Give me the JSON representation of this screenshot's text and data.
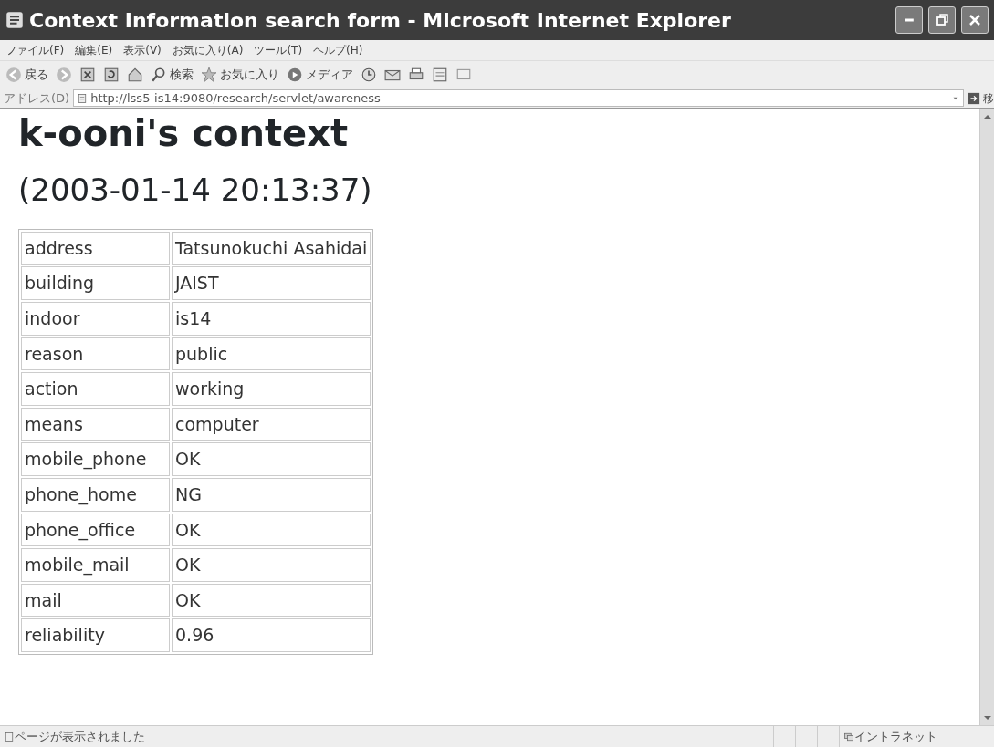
{
  "window": {
    "title": "Context Information search form - Microsoft Internet Explorer"
  },
  "menu": [
    "ファイル(F)",
    "編集(E)",
    "表示(V)",
    "お気に入り(A)",
    "ツール(T)",
    "ヘルプ(H)"
  ],
  "toolbar": [
    {
      "kind": "back",
      "label": "戻る"
    },
    {
      "kind": "forward"
    },
    {
      "kind": "stop"
    },
    {
      "kind": "refresh"
    },
    {
      "kind": "home"
    },
    {
      "kind": "search",
      "label": "検索"
    },
    {
      "kind": "favorites",
      "label": "お気に入り"
    },
    {
      "kind": "media",
      "label": "メディア"
    },
    {
      "kind": "history"
    },
    {
      "kind": "mail"
    },
    {
      "kind": "print"
    },
    {
      "kind": "edit"
    },
    {
      "kind": "discuss"
    }
  ],
  "address_bar": {
    "label": "アドレス(D)",
    "url": "http://lss5-is14:9080/research/servlet/awareness",
    "go": "移"
  },
  "page": {
    "heading": "k-ooni's context",
    "timestamp": "(2003-01-14 20:13:37)",
    "rows": [
      {
        "key": "address",
        "value": "Tatsunokuchi Asahidai"
      },
      {
        "key": "building",
        "value": "JAIST"
      },
      {
        "key": "indoor",
        "value": "is14"
      },
      {
        "key": "reason",
        "value": "public"
      },
      {
        "key": "action",
        "value": "working"
      },
      {
        "key": "means",
        "value": "computer"
      },
      {
        "key": "mobile_phone",
        "value": "OK"
      },
      {
        "key": "phone_home",
        "value": "NG"
      },
      {
        "key": "phone_office",
        "value": "OK"
      },
      {
        "key": "mobile_mail",
        "value": "OK"
      },
      {
        "key": "mail",
        "value": "OK"
      },
      {
        "key": "reliability",
        "value": "0.96"
      }
    ]
  },
  "status_bar": {
    "text": "ページが表示されました",
    "zone": "イントラネット"
  }
}
